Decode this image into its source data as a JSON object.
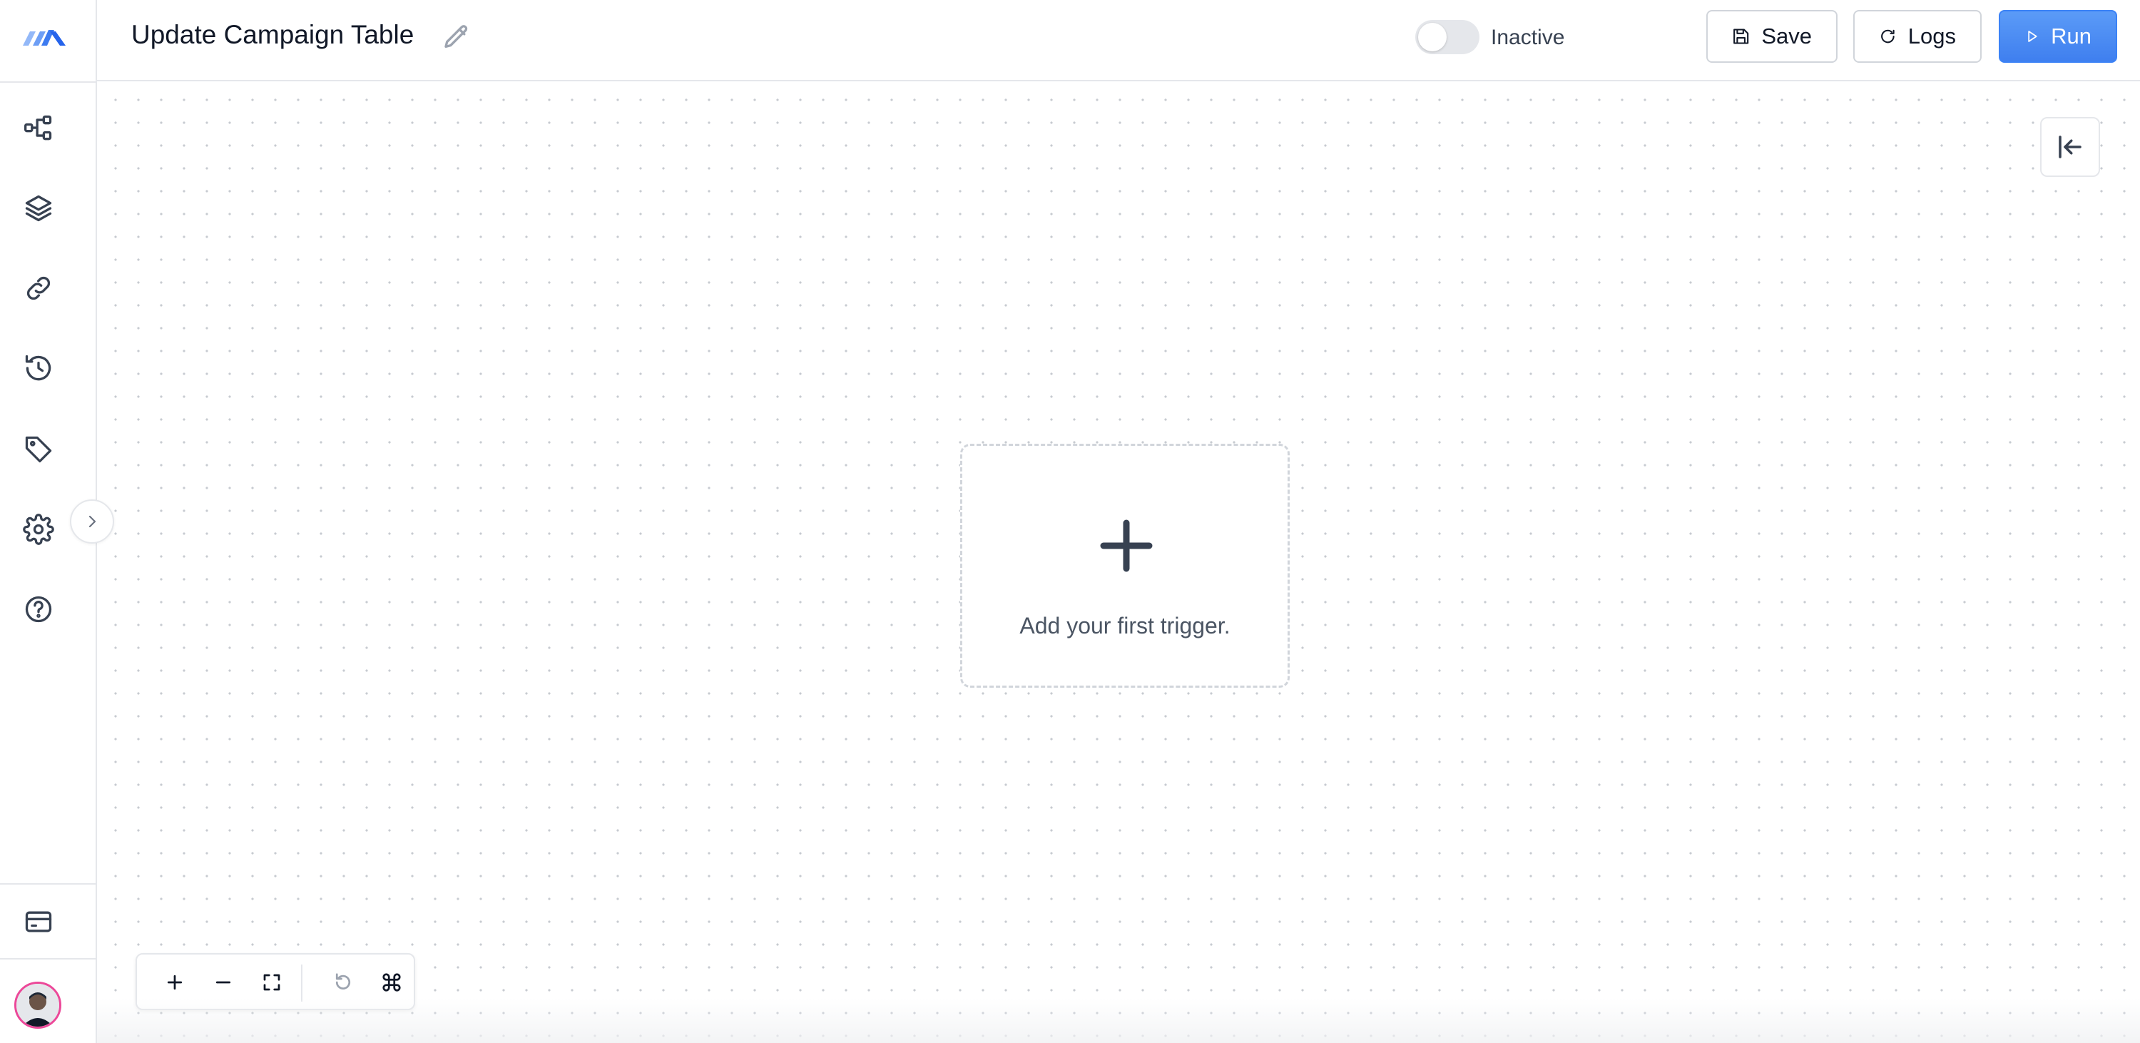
{
  "header": {
    "title": "Update Campaign Table",
    "status_label": "Inactive",
    "save_label": "Save",
    "logs_label": "Logs",
    "run_label": "Run"
  },
  "canvas": {
    "empty_state_text": "Add your first trigger."
  },
  "sidebar": {
    "items": [
      {
        "icon": "workflow-icon"
      },
      {
        "icon": "layers-icon"
      },
      {
        "icon": "link-icon"
      },
      {
        "icon": "history-icon"
      },
      {
        "icon": "tag-icon"
      },
      {
        "icon": "gear-icon"
      },
      {
        "icon": "help-icon"
      }
    ],
    "bottom_items": [
      {
        "icon": "billing-card-icon"
      },
      {
        "icon": "avatar"
      }
    ]
  },
  "controls": [
    "zoom-in-icon",
    "zoom-out-icon",
    "fit-view-icon",
    "undo-icon",
    "command-icon"
  ],
  "colors": {
    "accent": "#3b82f6",
    "avatar_ring": "#ec4899",
    "border": "#e5e7eb"
  }
}
